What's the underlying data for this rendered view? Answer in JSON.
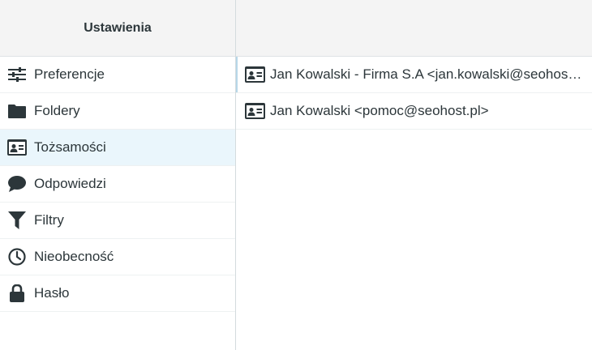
{
  "sidebar": {
    "title": "Ustawienia",
    "items": [
      {
        "label": "Preferencje",
        "icon": "sliders-icon"
      },
      {
        "label": "Foldery",
        "icon": "folder-icon"
      },
      {
        "label": "Tożsamości",
        "icon": "id-card-icon",
        "selected": true
      },
      {
        "label": "Odpowiedzi",
        "icon": "speech-bubble-icon"
      },
      {
        "label": "Filtry",
        "icon": "filter-icon"
      },
      {
        "label": "Nieobecność",
        "icon": "clock-icon"
      },
      {
        "label": "Hasło",
        "icon": "lock-icon"
      }
    ]
  },
  "identities": {
    "items": [
      {
        "label": "Jan Kowalski - Firma S.A <jan.kowalski@seohost.pl>",
        "icon": "id-card-icon"
      },
      {
        "label": "Jan Kowalski <pomoc@seohost.pl>",
        "icon": "id-card-icon"
      }
    ]
  },
  "colors": {
    "selected_bg": "#eaf6fc",
    "header_bg": "#f4f4f4",
    "text": "#2c363a"
  }
}
